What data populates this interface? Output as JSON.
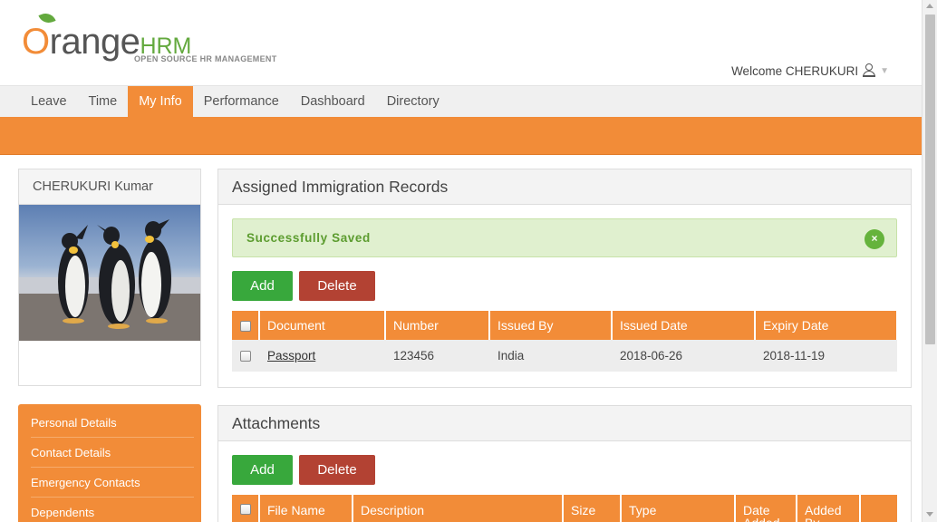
{
  "brand": {
    "word_o": "O",
    "word_rest": "range",
    "word_hrm": "HRM",
    "tagline": "OPEN SOURCE HR MANAGEMENT"
  },
  "header": {
    "welcome": "Welcome CHERUKURI"
  },
  "nav": [
    "Leave",
    "Time",
    "My Info",
    "Performance",
    "Dashboard",
    "Directory"
  ],
  "profile": {
    "name": "CHERUKURI Kumar"
  },
  "side_menu": [
    "Personal Details",
    "Contact Details",
    "Emergency Contacts",
    "Dependents"
  ],
  "immigration": {
    "title": "Assigned Immigration Records",
    "success_message": "Successfully Saved",
    "close_glyph": "×",
    "add_label": "Add",
    "delete_label": "Delete",
    "columns": [
      "Document",
      "Number",
      "Issued By",
      "Issued Date",
      "Expiry Date"
    ],
    "rows": [
      {
        "document": "Passport",
        "number": "123456",
        "issued_by": "India",
        "issued_date": "2018-06-26",
        "expiry_date": "2018-11-19"
      }
    ]
  },
  "attachments": {
    "title": "Attachments",
    "add_label": "Add",
    "delete_label": "Delete",
    "columns": [
      "File Name",
      "Description",
      "Size",
      "Type",
      "Date Added",
      "Added By"
    ]
  },
  "colors": {
    "accent": "#f28c38",
    "add_button": "#38a83c",
    "delete_button": "#b34233",
    "success_bg": "#e0f0cf"
  }
}
